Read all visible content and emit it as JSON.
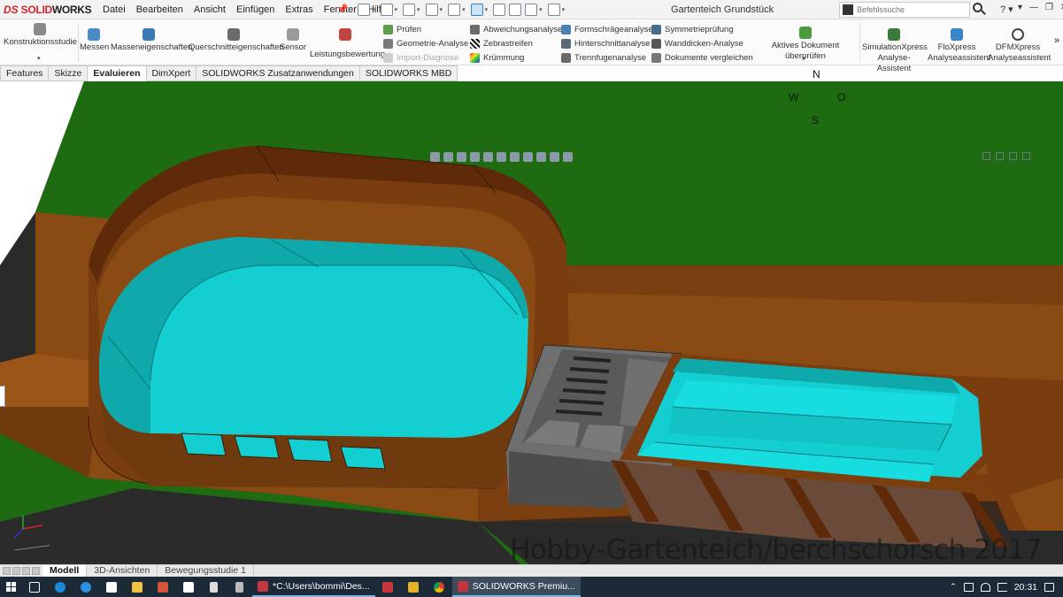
{
  "app": {
    "logo_ds": "DS",
    "logo_text_red": "SOLID",
    "logo_text_dark": "WORKS",
    "document_title": "Gartenteich Grundstück"
  },
  "menu": [
    "Datei",
    "Bearbeiten",
    "Ansicht",
    "Einfügen",
    "Extras",
    "Fenster",
    "Hilfe"
  ],
  "command_search": {
    "placeholder": "Befehlssuche"
  },
  "help_label": "?",
  "ribbon": {
    "large": [
      {
        "label": "Konstruktionsstudie",
        "icon": "design-study-icon"
      },
      {
        "label": "Messen",
        "icon": "measure-icon"
      },
      {
        "label": "Masseneigenschaften",
        "icon": "mass-properties-icon"
      },
      {
        "label": "Querschnitteigenschaften",
        "icon": "section-properties-icon"
      },
      {
        "label": "Sensor",
        "icon": "sensor-icon"
      },
      {
        "label": "Leistungsbewertung",
        "icon": "performance-icon"
      }
    ],
    "col1": [
      {
        "label": "Prüfen",
        "icon": "check-icon",
        "enabled": true
      },
      {
        "label": "Geometrie-Analyse",
        "icon": "geometry-analysis-icon",
        "enabled": true
      },
      {
        "label": "Import-Diagnose",
        "icon": "import-diagnostics-icon",
        "enabled": false
      }
    ],
    "col2": [
      {
        "label": "Abweichungsanalyse",
        "icon": "deviation-icon"
      },
      {
        "label": "Zebrastreifen",
        "icon": "zebra-icon"
      },
      {
        "label": "Krümmung",
        "icon": "curvature-icon"
      }
    ],
    "col3": [
      {
        "label": "Formschrägeanalyse",
        "icon": "draft-analysis-icon"
      },
      {
        "label": "Hinterschnittanalyse",
        "icon": "undercut-icon"
      },
      {
        "label": "Trennfugenanalyse",
        "icon": "parting-line-icon"
      }
    ],
    "col4": [
      {
        "label": "Symmetrieprüfung",
        "icon": "symmetry-icon"
      },
      {
        "label": "Wanddicken-Analyse",
        "icon": "thickness-icon"
      },
      {
        "label": "Dokumente vergleichen",
        "icon": "compare-icon"
      }
    ],
    "check_active": "Aktives Dokument überprüfen",
    "simulation": {
      "line1": "SimulationXpress",
      "line2": "Analyse-Assistent"
    },
    "floxpress": {
      "line1": "FloXpress",
      "line2": "Analyseassistent"
    },
    "dfmxpress": {
      "line1": "DFMXpress",
      "line2": "Analyseassistent"
    },
    "more": "»"
  },
  "tabs": [
    "Features",
    "Skizze",
    "Evaluieren",
    "DimXpert",
    "SOLIDWORKS Zusatzanwendungen",
    "SOLIDWORKS MBD"
  ],
  "active_tab": "Evaluieren",
  "compass": {
    "n": "N",
    "w": "W",
    "o": "O",
    "s": "S"
  },
  "watermark": "Hobby-Gartenteich/berchschorsch 2017",
  "model_tabs": [
    "Modell",
    "3D-Ansichten",
    "Bewegungsstudie 1"
  ],
  "taskbar": {
    "apps": [
      {
        "label": "*C:\\Users\\bommi\\Des...",
        "active": false
      },
      {
        "label": "SOLIDWORKS Premiu...",
        "active": true
      }
    ],
    "clock": "20:31"
  },
  "colors": {
    "grass": "#1f6b12",
    "wood": "#8a4a13",
    "wood_dark": "#5e2a0a",
    "water": "#14cfd2",
    "concrete": "#6f6f6f"
  }
}
